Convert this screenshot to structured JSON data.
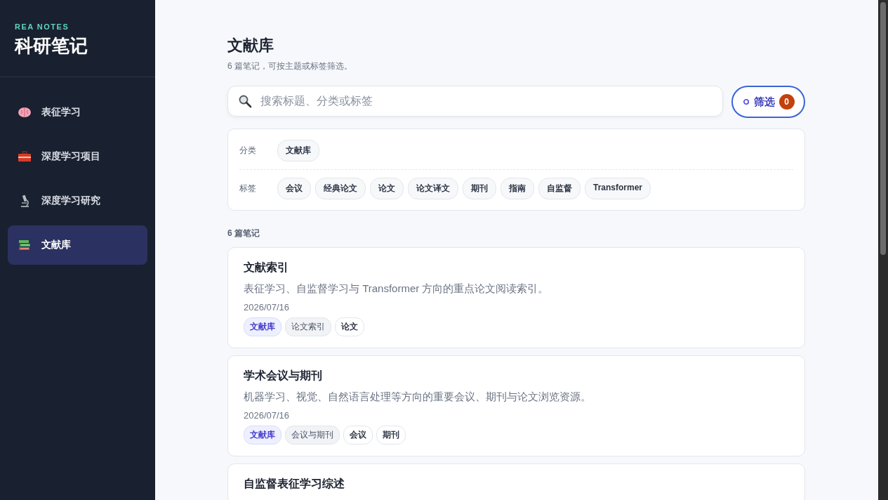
{
  "brand": {
    "eyebrow": "REA NOTES",
    "title": "科研笔记"
  },
  "sidebar": {
    "items": [
      {
        "label": "表征学习",
        "selected": false
      },
      {
        "label": "深度学习项目",
        "selected": false
      },
      {
        "label": "深度学习研究",
        "selected": false
      },
      {
        "label": "文献库",
        "selected": true
      }
    ]
  },
  "header": {
    "title": "文献库",
    "subtitle": "6 篇笔记，可按主题或标签筛选。"
  },
  "search": {
    "placeholder": "搜索标题、分类或标签"
  },
  "filter_button": {
    "label": "筛选",
    "count": "0"
  },
  "filters": [
    {
      "label": "分类",
      "chips": [
        "文献库"
      ]
    },
    {
      "label": "标签",
      "chips": [
        "会议",
        "经典论文",
        "论文",
        "论文译文",
        "期刊",
        "指南",
        "自监督",
        "Transformer"
      ]
    }
  ],
  "list_heading": "6 篇笔记",
  "notes": [
    {
      "title": "文献索引",
      "summary": "表征学习、自监督学习与 Transformer 方向的重点论文阅读索引。",
      "date": "2026/07/16",
      "tags": [
        {
          "label": "文献库",
          "kind": "category"
        },
        {
          "label": "论文索引",
          "kind": "topic"
        },
        {
          "label": "论文",
          "kind": "tag"
        }
      ]
    },
    {
      "title": "学术会议与期刊",
      "summary": "机器学习、视觉、自然语言处理等方向的重要会议、期刊与论文浏览资源。",
      "date": "2026/07/16",
      "tags": [
        {
          "label": "文献库",
          "kind": "category"
        },
        {
          "label": "会议与期刊",
          "kind": "topic"
        },
        {
          "label": "会议",
          "kind": "tag"
        },
        {
          "label": "期刊",
          "kind": "tag"
        }
      ]
    },
    {
      "title": "自监督表征学习综述"
    }
  ]
}
